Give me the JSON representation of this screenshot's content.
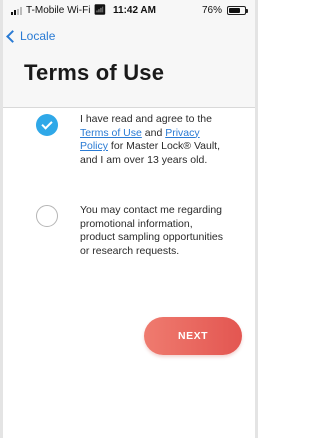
{
  "status_bar": {
    "carrier": "T-Mobile Wi-Fi",
    "wifi_icon": "wifi-icon",
    "time": "11:42 AM",
    "battery_text": "76%",
    "battery_level": 0.76
  },
  "nav": {
    "back_label": "Locale",
    "title": "Terms of Use"
  },
  "agreements": [
    {
      "checked": true,
      "text_before": "I have read and agree to the ",
      "link1": "Terms of Use",
      "text_mid": " and ",
      "link2": "Privacy Policy",
      "text_after": " for Master Lock® Vault, and I am over 13 years old."
    },
    {
      "checked": false,
      "text": "You may contact me regarding promotional information, product sampling opportunities or research requests."
    }
  ],
  "next_button": {
    "label": "NEXT"
  },
  "colors": {
    "accent_blue": "#2a7bd4",
    "check_blue": "#2fa8e8",
    "button_red": "#e35651"
  }
}
